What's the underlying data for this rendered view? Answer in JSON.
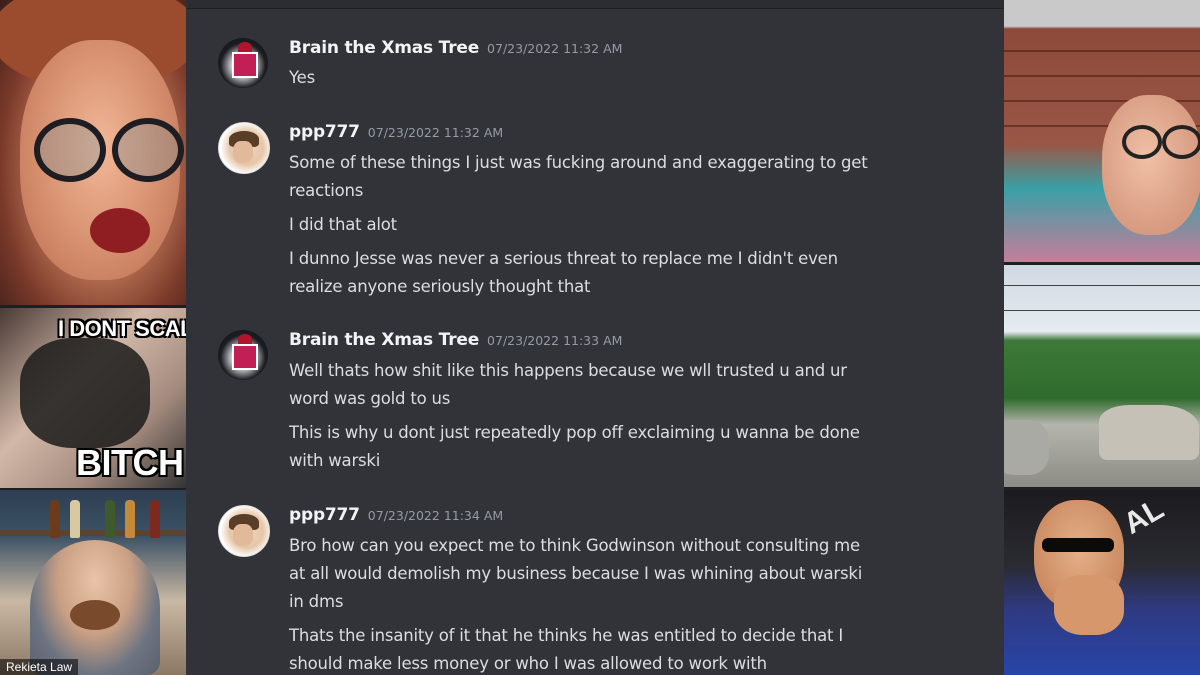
{
  "left_tiles": {
    "meme_top_text": "I DONT SCAL",
    "meme_bottom_text": "BITCH",
    "participant_name": "Rekieta Law"
  },
  "right_tiles": {
    "shirt_text": "AL"
  },
  "chat": {
    "messages": [
      {
        "username": "Brain the Xmas Tree",
        "timestamp": "07/23/2022 11:32 AM",
        "avatar": "xmas-tree-avatar",
        "lines": [
          "Yes"
        ]
      },
      {
        "username": "ppp777",
        "timestamp": "07/23/2022 11:32 AM",
        "avatar": "cartoon-face-avatar",
        "lines": [
          "Some of these things I just was fucking around and exaggerating to get",
          "reactions",
          "I did that alot",
          "I dunno Jesse was never a serious threat to replace me I didn't even",
          "realize anyone seriously thought that"
        ]
      },
      {
        "username": "Brain the Xmas Tree",
        "timestamp": "07/23/2022 11:33 AM",
        "avatar": "xmas-tree-avatar",
        "lines": [
          "Well thats how shit like this happens because we wll trusted u and ur",
          "word was gold to us",
          "This is why u dont just repeatedly pop off exclaiming u wanna be done",
          "with warski"
        ]
      },
      {
        "username": "ppp777",
        "timestamp": "07/23/2022 11:34 AM",
        "avatar": "cartoon-face-avatar",
        "lines": [
          "Bro how can you expect me to think Godwinson without consulting me",
          "at all would demolish my business because I was whining about warski",
          "in dms",
          "Thats the insanity of it that he thinks he was entitled to decide that I",
          "should make less money or who I was allowed to work with"
        ]
      }
    ]
  },
  "colors": {
    "chat_bg": "#313338",
    "username": "#f2f3f5",
    "timestamp": "#949ba4",
    "message_text": "#dbdee1"
  }
}
